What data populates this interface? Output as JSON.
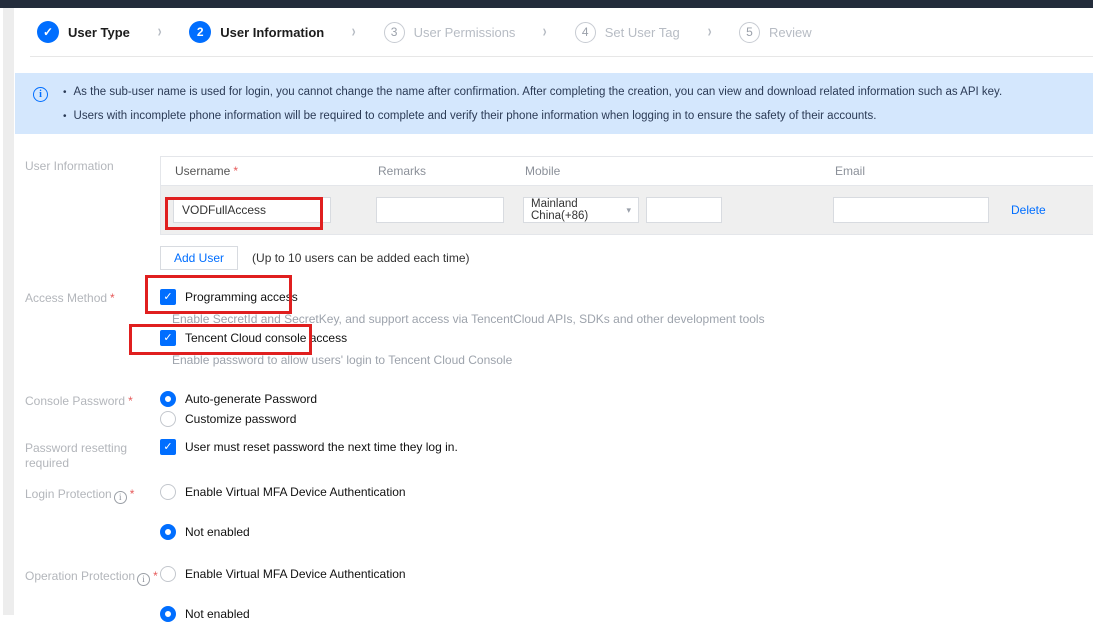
{
  "colors": {
    "accent": "#006eff",
    "topbar": "#232c3b",
    "banner_bg": "#d4e7fd",
    "annotation_red": "#e01f1f",
    "table_row_bg": "#efefef"
  },
  "icons": {
    "check": "✓",
    "step_separator": "›",
    "caret": "▾",
    "bullet": "•",
    "info": "i"
  },
  "ui": {
    "required_marker": "*"
  },
  "stepper": {
    "steps": [
      {
        "label": "User Type",
        "state": "completed"
      },
      {
        "number": "2",
        "label": "User Information",
        "state": "current"
      },
      {
        "number": "3",
        "label": "User Permissions",
        "state": "upcoming"
      },
      {
        "number": "4",
        "label": "Set User Tag",
        "state": "upcoming"
      },
      {
        "number": "5",
        "label": "Review",
        "state": "upcoming"
      }
    ]
  },
  "banner": {
    "bullets": [
      "As the sub-user name is used for login, you cannot change the name after confirmation. After completing the creation, you can view and download related information such as API key.",
      "Users with incomplete phone information will be required to complete and verify their phone information when logging in to ensure the safety of their accounts."
    ]
  },
  "form": {
    "user_information": {
      "label": "User Information",
      "headers": {
        "username": "Username",
        "remarks": "Remarks",
        "mobile": "Mobile",
        "email": "Email"
      },
      "row": {
        "username": "VODFullAccess",
        "remarks": "",
        "mobile_country": "Mainland China(+86)",
        "mobile": "",
        "email": "",
        "delete_label": "Delete"
      },
      "add_user_label": "Add User",
      "add_user_note": "(Up to 10 users can be added each time)"
    },
    "access_method": {
      "label": "Access Method",
      "options": [
        {
          "label": "Programming access",
          "checked": true,
          "description": "Enable SecretId and SecretKey, and support access via TencentCloud APIs, SDKs and other development tools"
        },
        {
          "label": "Tencent Cloud console access",
          "checked": true,
          "description": "Enable password to allow users' login to Tencent Cloud Console"
        }
      ]
    },
    "console_password": {
      "label": "Console Password",
      "options": [
        {
          "label": "Auto-generate Password",
          "selected": true
        },
        {
          "label": "Customize password",
          "selected": false
        }
      ]
    },
    "password_reset": {
      "label": "Password resetting required",
      "option": "User must reset password the next time they log in.",
      "checked": true
    },
    "login_protection": {
      "label": "Login Protection",
      "options": [
        {
          "label": "Enable Virtual MFA Device Authentication",
          "selected": false
        },
        {
          "label": "Not enabled",
          "selected": true
        }
      ]
    },
    "operation_protection": {
      "label": "Operation Protection",
      "options": [
        {
          "label": "Enable Virtual MFA Device Authentication",
          "selected": false
        },
        {
          "label": "Not enabled",
          "selected": true
        }
      ]
    }
  }
}
